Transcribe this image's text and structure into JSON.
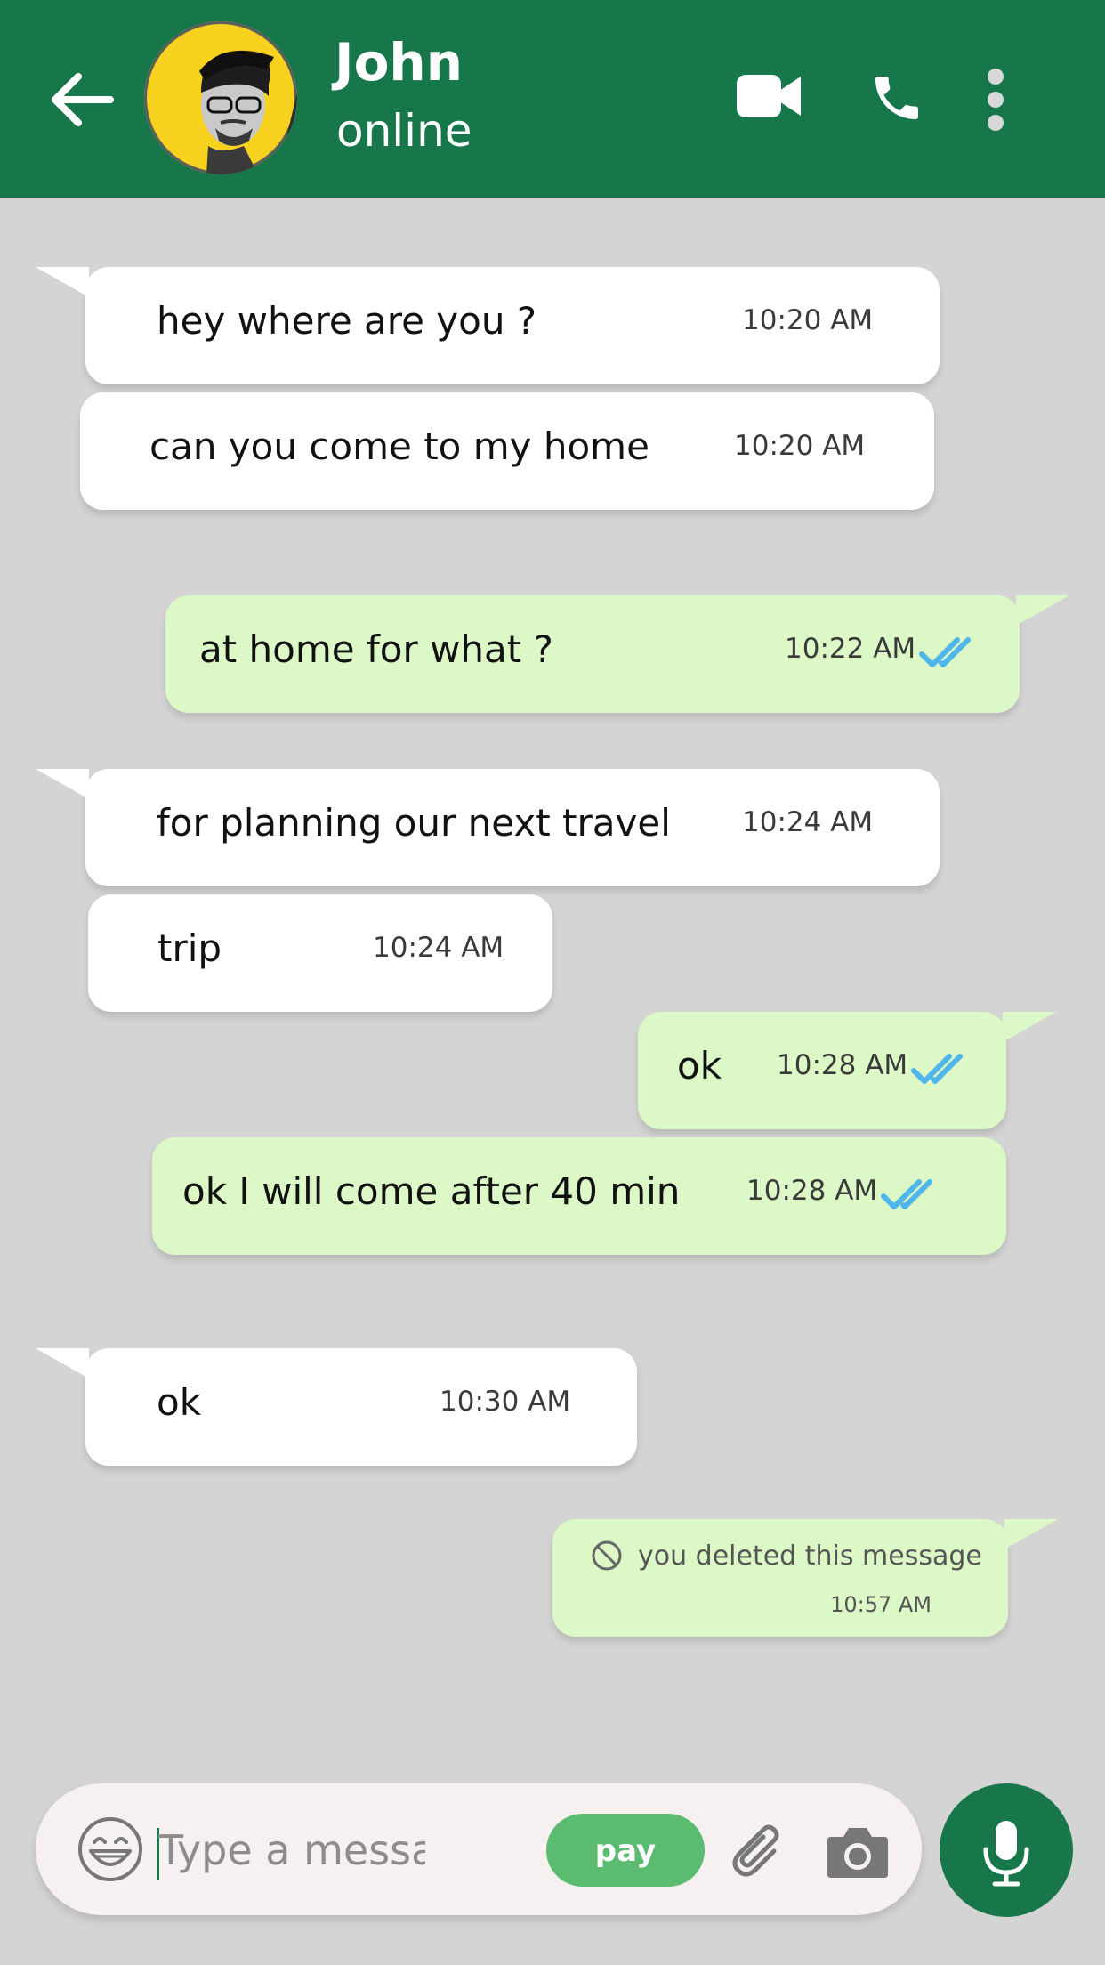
{
  "header": {
    "name": "John",
    "status": "online",
    "colors": {
      "bar": "#17774a",
      "avatar_bg": "#f6d21f"
    },
    "icons": [
      "arrow-left-icon",
      "video-camera-icon",
      "phone-icon",
      "more-vertical-icon"
    ]
  },
  "messages": [
    {
      "dir": "in",
      "text": "hey where are you ?",
      "time": "10:20 AM"
    },
    {
      "dir": "in",
      "text": "can you come to my home",
      "time": "10:20 AM"
    },
    {
      "dir": "out",
      "text": "at home for what ?",
      "time": "10:22 AM",
      "read": true
    },
    {
      "dir": "in",
      "text": "for planning our next travel",
      "time": "10:24 AM"
    },
    {
      "dir": "in",
      "text": "trip",
      "time": "10:24 AM"
    },
    {
      "dir": "out",
      "text": "ok",
      "time": "10:28 AM",
      "read": true
    },
    {
      "dir": "out",
      "text": "ok I will come after 40 min",
      "time": "10:28 AM",
      "read": true
    },
    {
      "dir": "in",
      "text": "ok",
      "time": "10:30 AM"
    },
    {
      "dir": "out",
      "text": "you deleted this message",
      "time": "10:57 AM",
      "deleted": true
    }
  ],
  "composer": {
    "placeholder": "Type a message",
    "pay_label": "pay",
    "icons": [
      "emoji-icon",
      "paperclip-icon",
      "camera-icon",
      "microphone-icon"
    ]
  },
  "colors": {
    "incoming": "#ffffff",
    "outgoing": "#dcf8c6",
    "read_ticks": "#4fb6ec",
    "background": "#d4d4d4"
  }
}
